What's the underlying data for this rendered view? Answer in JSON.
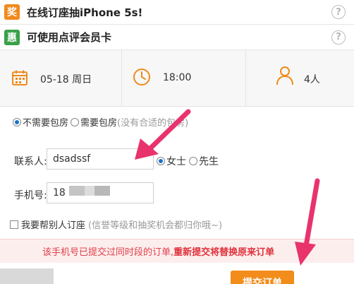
{
  "promos": [
    {
      "badge": "奖",
      "text": "在线订座抽iPhone 5s!",
      "help": "?"
    },
    {
      "badge": "惠",
      "text": "可使用点评会员卡",
      "help": "?"
    }
  ],
  "selection": {
    "date": "05-18 周日",
    "time": "18:00",
    "people": "4人"
  },
  "room": {
    "option1": "不需要包房",
    "option2": "需要包房",
    "hint": "(没有合适的包房)"
  },
  "contact": {
    "label": "联系人:",
    "value": "dsadssf",
    "gender_female": "女士",
    "gender_male": "先生"
  },
  "phone": {
    "label": "手机号:",
    "value_prefix": "18"
  },
  "help_other": {
    "label": "我要帮别人订座",
    "hint": "(信誉等级和抽奖机会都归你哦~)"
  },
  "warning": {
    "text": "该手机号已提交过同时段的订单,",
    "bold": "重新提交将替换原来订单"
  },
  "submit": {
    "label": "提交订单"
  },
  "colors": {
    "accent_orange": "#f28c1a",
    "badge_green": "#3aa04a",
    "warning_red": "#e0404a",
    "annotation_pink": "#e8336d"
  }
}
